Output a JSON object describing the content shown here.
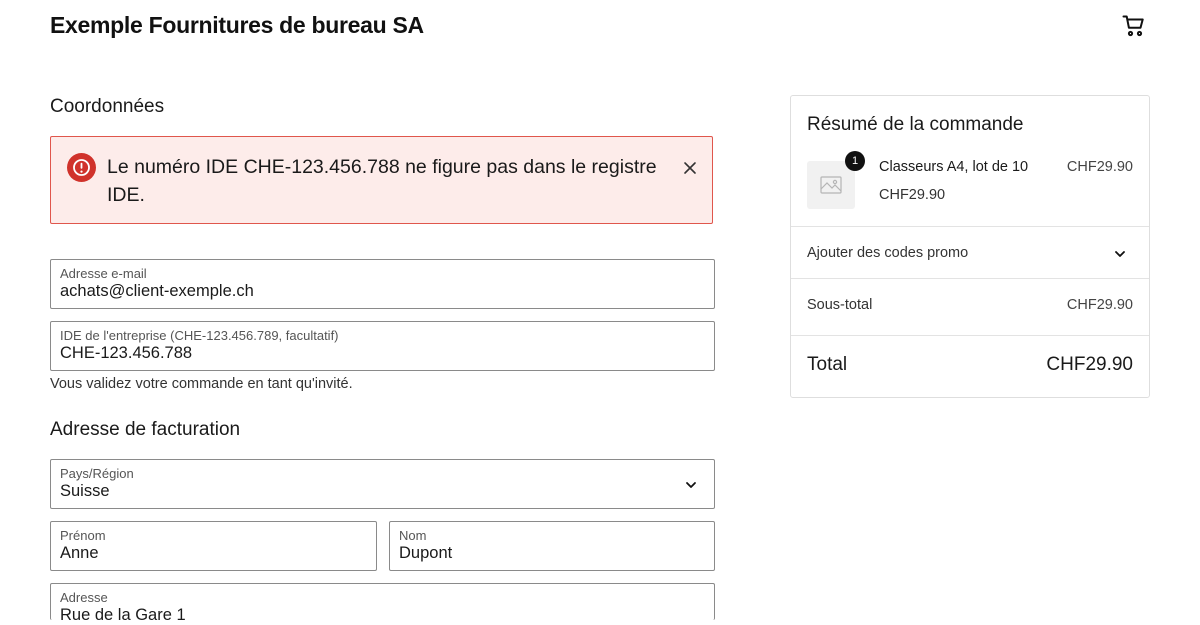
{
  "header": {
    "store_name": "Exemple Fournitures de bureau SA",
    "cart_icon": "cart-icon"
  },
  "contact": {
    "title": "Coordonnées",
    "error": {
      "message": "Le numéro IDE CHE-123.456.788 ne figure pas dans le registre IDE.",
      "icon": "error-icon",
      "color": "#d0322b"
    },
    "email": {
      "label": "Adresse e-mail",
      "value": "achats@client-exemple.ch"
    },
    "uid": {
      "label": "IDE de l'entreprise (CHE-123.456.789, facultatif)",
      "value": "CHE-123.456.788"
    },
    "guest_note": "Vous validez votre commande en tant qu'invité."
  },
  "billing": {
    "title": "Adresse de facturation",
    "country": {
      "label": "Pays/Région",
      "value": "Suisse"
    },
    "first_name": {
      "label": "Prénom",
      "value": "Anne"
    },
    "last_name": {
      "label": "Nom",
      "value": "Dupont"
    },
    "address": {
      "label": "Adresse",
      "value": "Rue de la Gare 1"
    }
  },
  "summary": {
    "title": "Résumé de la commande",
    "item": {
      "quantity": "1",
      "name": "Classeurs A4, lot de 10",
      "unit_price": "CHF29.90",
      "price": "CHF29.90"
    },
    "promo_label": "Ajouter des codes promo",
    "subtotal_label": "Sous-total",
    "subtotal_value": "CHF29.90",
    "total_label": "Total",
    "total_value": "CHF29.90"
  }
}
